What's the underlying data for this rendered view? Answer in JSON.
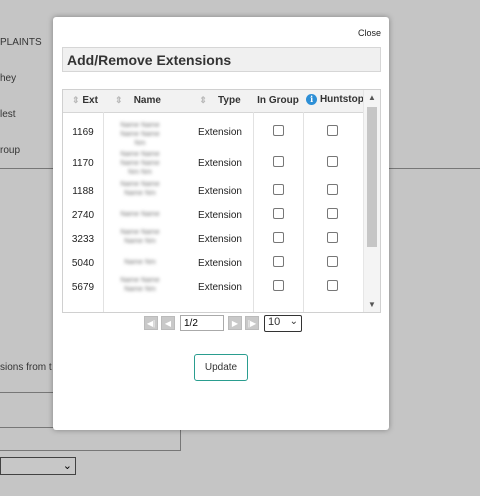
{
  "background": {
    "labels": [
      "PLAINTS",
      "hey",
      "lest",
      "roup",
      "sions from t"
    ]
  },
  "modal": {
    "close_label": "Close",
    "title": "Add/Remove Extensions",
    "columns": {
      "ext": "Ext",
      "name": "Name",
      "type": "Type",
      "in_group": "In Group",
      "huntstop": "Huntstop"
    },
    "rows": [
      {
        "ext": "1169",
        "type": "Extension",
        "in_group": false,
        "huntstop": false
      },
      {
        "ext": "1170",
        "type": "Extension",
        "in_group": false,
        "huntstop": false
      },
      {
        "ext": "1188",
        "type": "Extension",
        "in_group": false,
        "huntstop": false
      },
      {
        "ext": "2740",
        "type": "Extension",
        "in_group": false,
        "huntstop": false
      },
      {
        "ext": "3233",
        "type": "Extension",
        "in_group": false,
        "huntstop": false
      },
      {
        "ext": "5040",
        "type": "Extension",
        "in_group": false,
        "huntstop": false
      },
      {
        "ext": "5679",
        "type": "Extension",
        "in_group": false,
        "huntstop": false
      }
    ],
    "pager": {
      "page_value": "1/2",
      "page_size": "10"
    },
    "update_label": "Update"
  },
  "colors": {
    "info_icon": "#2d8fd6",
    "update_border": "#2a9d8f"
  }
}
